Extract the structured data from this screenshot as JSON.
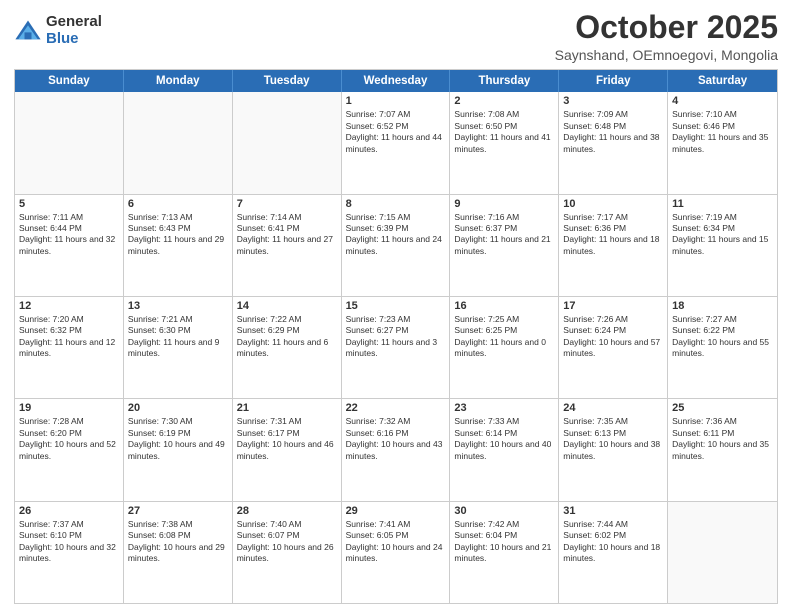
{
  "logo": {
    "general": "General",
    "blue": "Blue"
  },
  "title": "October 2025",
  "subtitle": "Saynshand, OEmnoegovi, Mongolia",
  "days": [
    "Sunday",
    "Monday",
    "Tuesday",
    "Wednesday",
    "Thursday",
    "Friday",
    "Saturday"
  ],
  "weeks": [
    [
      {
        "day": "",
        "text": ""
      },
      {
        "day": "",
        "text": ""
      },
      {
        "day": "",
        "text": ""
      },
      {
        "day": "1",
        "text": "Sunrise: 7:07 AM\nSunset: 6:52 PM\nDaylight: 11 hours and 44 minutes."
      },
      {
        "day": "2",
        "text": "Sunrise: 7:08 AM\nSunset: 6:50 PM\nDaylight: 11 hours and 41 minutes."
      },
      {
        "day": "3",
        "text": "Sunrise: 7:09 AM\nSunset: 6:48 PM\nDaylight: 11 hours and 38 minutes."
      },
      {
        "day": "4",
        "text": "Sunrise: 7:10 AM\nSunset: 6:46 PM\nDaylight: 11 hours and 35 minutes."
      }
    ],
    [
      {
        "day": "5",
        "text": "Sunrise: 7:11 AM\nSunset: 6:44 PM\nDaylight: 11 hours and 32 minutes."
      },
      {
        "day": "6",
        "text": "Sunrise: 7:13 AM\nSunset: 6:43 PM\nDaylight: 11 hours and 29 minutes."
      },
      {
        "day": "7",
        "text": "Sunrise: 7:14 AM\nSunset: 6:41 PM\nDaylight: 11 hours and 27 minutes."
      },
      {
        "day": "8",
        "text": "Sunrise: 7:15 AM\nSunset: 6:39 PM\nDaylight: 11 hours and 24 minutes."
      },
      {
        "day": "9",
        "text": "Sunrise: 7:16 AM\nSunset: 6:37 PM\nDaylight: 11 hours and 21 minutes."
      },
      {
        "day": "10",
        "text": "Sunrise: 7:17 AM\nSunset: 6:36 PM\nDaylight: 11 hours and 18 minutes."
      },
      {
        "day": "11",
        "text": "Sunrise: 7:19 AM\nSunset: 6:34 PM\nDaylight: 11 hours and 15 minutes."
      }
    ],
    [
      {
        "day": "12",
        "text": "Sunrise: 7:20 AM\nSunset: 6:32 PM\nDaylight: 11 hours and 12 minutes."
      },
      {
        "day": "13",
        "text": "Sunrise: 7:21 AM\nSunset: 6:30 PM\nDaylight: 11 hours and 9 minutes."
      },
      {
        "day": "14",
        "text": "Sunrise: 7:22 AM\nSunset: 6:29 PM\nDaylight: 11 hours and 6 minutes."
      },
      {
        "day": "15",
        "text": "Sunrise: 7:23 AM\nSunset: 6:27 PM\nDaylight: 11 hours and 3 minutes."
      },
      {
        "day": "16",
        "text": "Sunrise: 7:25 AM\nSunset: 6:25 PM\nDaylight: 11 hours and 0 minutes."
      },
      {
        "day": "17",
        "text": "Sunrise: 7:26 AM\nSunset: 6:24 PM\nDaylight: 10 hours and 57 minutes."
      },
      {
        "day": "18",
        "text": "Sunrise: 7:27 AM\nSunset: 6:22 PM\nDaylight: 10 hours and 55 minutes."
      }
    ],
    [
      {
        "day": "19",
        "text": "Sunrise: 7:28 AM\nSunset: 6:20 PM\nDaylight: 10 hours and 52 minutes."
      },
      {
        "day": "20",
        "text": "Sunrise: 7:30 AM\nSunset: 6:19 PM\nDaylight: 10 hours and 49 minutes."
      },
      {
        "day": "21",
        "text": "Sunrise: 7:31 AM\nSunset: 6:17 PM\nDaylight: 10 hours and 46 minutes."
      },
      {
        "day": "22",
        "text": "Sunrise: 7:32 AM\nSunset: 6:16 PM\nDaylight: 10 hours and 43 minutes."
      },
      {
        "day": "23",
        "text": "Sunrise: 7:33 AM\nSunset: 6:14 PM\nDaylight: 10 hours and 40 minutes."
      },
      {
        "day": "24",
        "text": "Sunrise: 7:35 AM\nSunset: 6:13 PM\nDaylight: 10 hours and 38 minutes."
      },
      {
        "day": "25",
        "text": "Sunrise: 7:36 AM\nSunset: 6:11 PM\nDaylight: 10 hours and 35 minutes."
      }
    ],
    [
      {
        "day": "26",
        "text": "Sunrise: 7:37 AM\nSunset: 6:10 PM\nDaylight: 10 hours and 32 minutes."
      },
      {
        "day": "27",
        "text": "Sunrise: 7:38 AM\nSunset: 6:08 PM\nDaylight: 10 hours and 29 minutes."
      },
      {
        "day": "28",
        "text": "Sunrise: 7:40 AM\nSunset: 6:07 PM\nDaylight: 10 hours and 26 minutes."
      },
      {
        "day": "29",
        "text": "Sunrise: 7:41 AM\nSunset: 6:05 PM\nDaylight: 10 hours and 24 minutes."
      },
      {
        "day": "30",
        "text": "Sunrise: 7:42 AM\nSunset: 6:04 PM\nDaylight: 10 hours and 21 minutes."
      },
      {
        "day": "31",
        "text": "Sunrise: 7:44 AM\nSunset: 6:02 PM\nDaylight: 10 hours and 18 minutes."
      },
      {
        "day": "",
        "text": ""
      }
    ]
  ]
}
